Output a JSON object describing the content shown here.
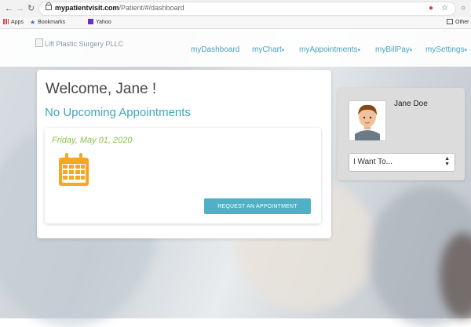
{
  "browser": {
    "url_host": "mypatientvisit.com",
    "url_path": "/Patient/#/dashboard",
    "bookmarks": [
      {
        "label": "Apps",
        "icon": "apps-grid-icon",
        "color": "#d44"
      },
      {
        "label": "Bookmarks",
        "icon": "star-icon",
        "color": "#3a6fd8"
      },
      {
        "label": "Yahoo",
        "icon": "yahoo-icon",
        "color": "#6b2dc9"
      }
    ],
    "other_bookmarks": "Other"
  },
  "header": {
    "logo_alt": "Lift Plastic Surgery PLLC",
    "nav": [
      {
        "label": "myDashboard",
        "dropdown": false
      },
      {
        "label": "myChart",
        "dropdown": true
      },
      {
        "label": "myAppointments",
        "dropdown": true
      },
      {
        "label": "myBillPay",
        "dropdown": true
      },
      {
        "label": "mySettings",
        "dropdown": true
      }
    ]
  },
  "main": {
    "welcome": "Welcome, Jane !",
    "appointments_status": "No Upcoming Appointments",
    "card": {
      "date": "Friday, May 01, 2020",
      "calendar_icon": "calendar-icon",
      "button_label": "REQUEST AN APPOINTMENT"
    }
  },
  "profile": {
    "name": "Jane Doe",
    "avatar_icon": "user-avatar-icon",
    "select_value": "I Want To..."
  },
  "colors": {
    "accent": "#3ea6c0",
    "button": "#4fb0c6",
    "date": "#8bc34a",
    "calendar": "#f5a623"
  }
}
